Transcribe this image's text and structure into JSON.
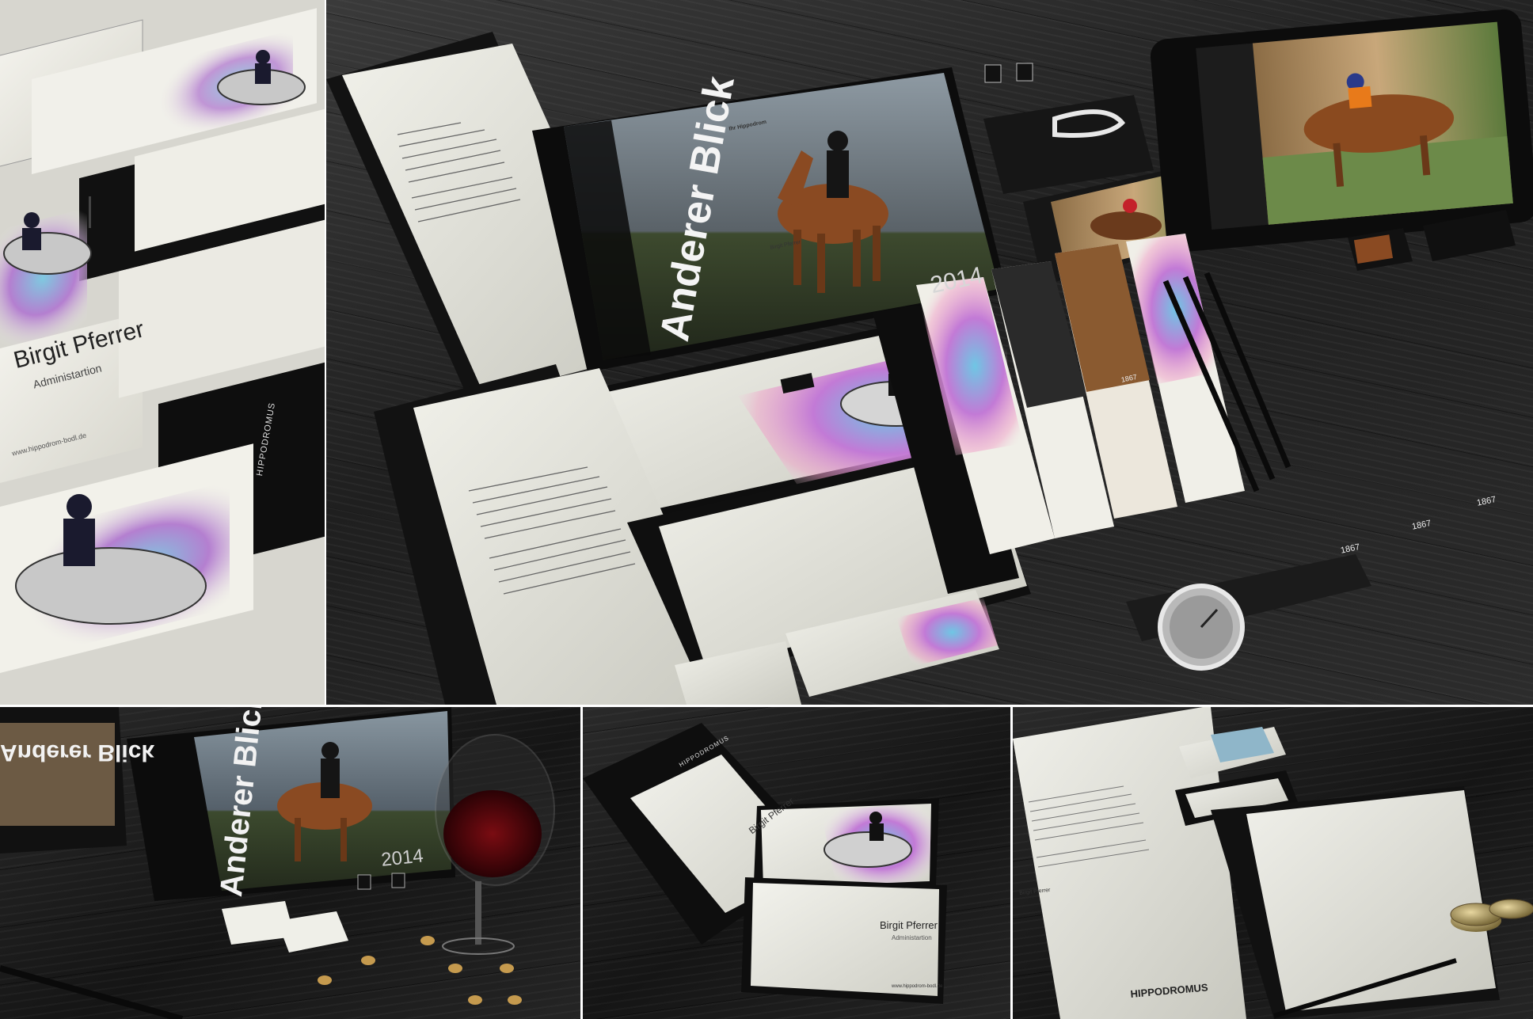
{
  "brand": {
    "name": "HIPPODROMUS",
    "year_badge": "1867"
  },
  "book": {
    "title": "Anderer Blick",
    "year": "2014"
  },
  "business_card": {
    "name": "Birgit Pferrer",
    "role": "Administartion",
    "web": "www.hippodrom-bodl.de"
  },
  "letter": {
    "salutation": "Ihr Hippodrom",
    "closing_name": "Birgit Pferrer"
  }
}
